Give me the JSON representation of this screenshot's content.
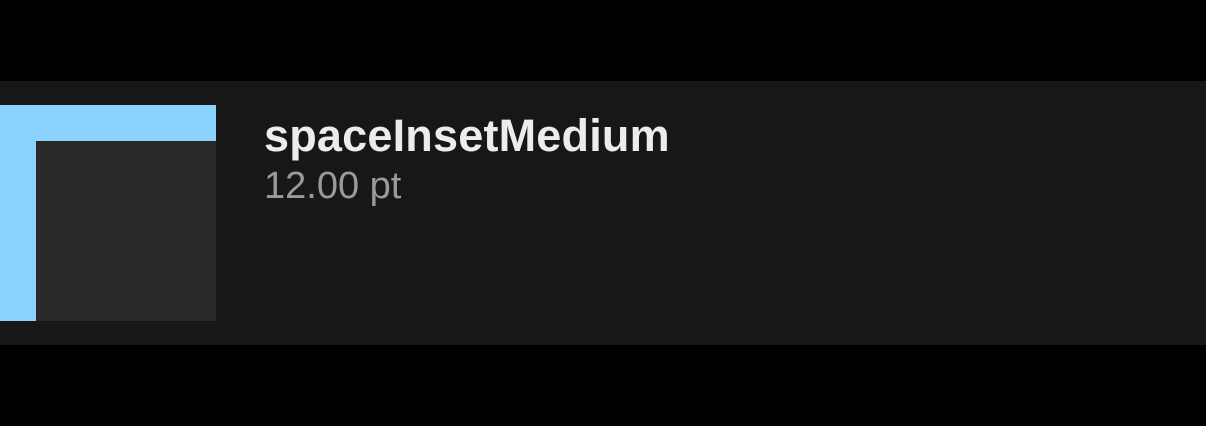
{
  "token": {
    "name": "spaceInsetMedium",
    "value": "12.00 pt",
    "swatch": {
      "inset_color": "#8ad3ff",
      "content_color": "#282828"
    }
  },
  "colors": {
    "background": "#000000",
    "row_background": "#171717",
    "name_text": "#ececec",
    "value_text": "#9a9a9a"
  }
}
